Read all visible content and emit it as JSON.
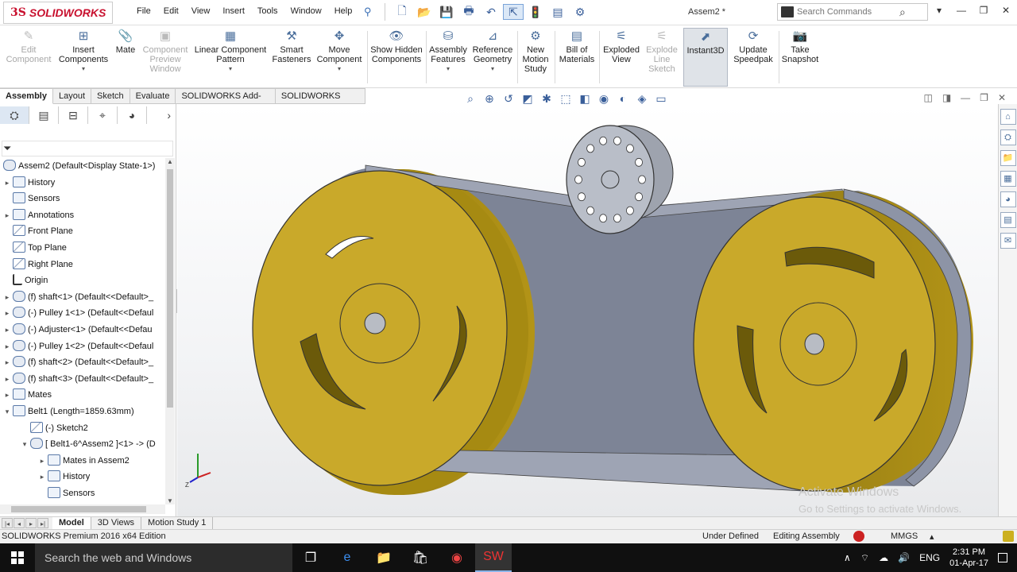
{
  "app": {
    "logo_ds": "3S",
    "logo_name": "SOLIDWORKS",
    "menu": [
      "File",
      "Edit",
      "View",
      "Insert",
      "Tools",
      "Window",
      "Help"
    ],
    "doc_title": "Assem2 *",
    "search_placeholder": "Search Commands"
  },
  "ribbon": {
    "edit_component": "Edit Component",
    "insert_components": "Insert Components",
    "mate": "Mate",
    "component_preview": "Component Preview Window",
    "linear_pattern": "Linear Component Pattern",
    "smart_fasteners": "Smart Fasteners",
    "move_component": "Move Component",
    "show_hidden": "Show Hidden Components",
    "assembly_features": "Assembly Features",
    "reference_geometry": "Reference Geometry",
    "new_motion_study": "New Motion Study",
    "bill_of_materials": "Bill of Materials",
    "exploded_view": "Exploded View",
    "explode_line_sketch": "Explode Line Sketch",
    "instant3d": "Instant3D",
    "update_speedpak": "Update Speedpak",
    "take_snapshot": "Take Snapshot"
  },
  "tabs": [
    "Assembly",
    "Layout",
    "Sketch",
    "Evaluate",
    "SOLIDWORKS Add-Ins",
    "SOLIDWORKS MBD"
  ],
  "tree": {
    "root": "Assem2  (Default<Display State-1>)",
    "items": [
      {
        "label": "History",
        "exp": "▸"
      },
      {
        "label": "Sensors",
        "exp": ""
      },
      {
        "label": "Annotations",
        "exp": "▸"
      },
      {
        "label": "Front Plane",
        "exp": ""
      },
      {
        "label": "Top Plane",
        "exp": ""
      },
      {
        "label": "Right Plane",
        "exp": ""
      },
      {
        "label": "Origin",
        "exp": ""
      },
      {
        "label": "(f) shaft<1> (Default<<Default>_",
        "exp": "▸"
      },
      {
        "label": "(-) Pulley 1<1> (Default<<Defaul",
        "exp": "▸"
      },
      {
        "label": "(-) Adjuster<1> (Default<<Defau",
        "exp": "▸"
      },
      {
        "label": "(-) Pulley 1<2> (Default<<Defaul",
        "exp": "▸"
      },
      {
        "label": "(f) shaft<2> (Default<<Default>_",
        "exp": "▸"
      },
      {
        "label": "(f) shaft<3> (Default<<Default>_",
        "exp": "▸"
      },
      {
        "label": "Mates",
        "exp": "▸"
      },
      {
        "label": "Belt1 (Length=1859.63mm)",
        "exp": "▾"
      },
      {
        "label": "(-) Sketch2",
        "exp": ""
      },
      {
        "label": "[ Belt1-6^Assem2 ]<1> -> (D",
        "exp": "▾"
      },
      {
        "label": "Mates in Assem2",
        "exp": "▸"
      },
      {
        "label": "History",
        "exp": "▸"
      },
      {
        "label": "Sensors",
        "exp": ""
      }
    ]
  },
  "bottom_tabs": [
    "Model",
    "3D Views",
    "Motion Study 1"
  ],
  "status": {
    "product": "SOLIDWORKS Premium 2016 x64 Edition",
    "state": "Under Defined",
    "mode": "Editing Assembly",
    "units": "MMGS"
  },
  "watermark": {
    "title": "Activate Windows",
    "subtitle": "Go to Settings to activate Windows."
  },
  "taskbar": {
    "search": "Search the web and Windows",
    "lang": "ENG",
    "time": "2:31 PM",
    "date": "01-Apr-17"
  },
  "colors": {
    "pulley": "#c9a92a",
    "belt": "#8d94a6",
    "adjuster": "#b9bec8",
    "brand": "#c8102e"
  }
}
